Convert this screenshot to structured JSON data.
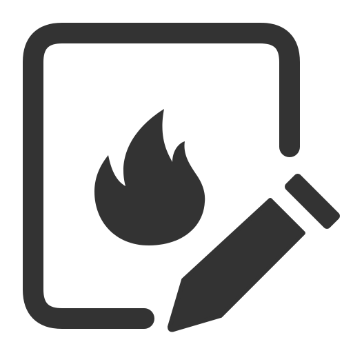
{
  "icon": {
    "name": "edit-fire-document-icon",
    "parts": [
      "document-frame-icon",
      "fire-icon",
      "pencil-icon"
    ],
    "color": "#333333",
    "background": "#ffffff"
  }
}
